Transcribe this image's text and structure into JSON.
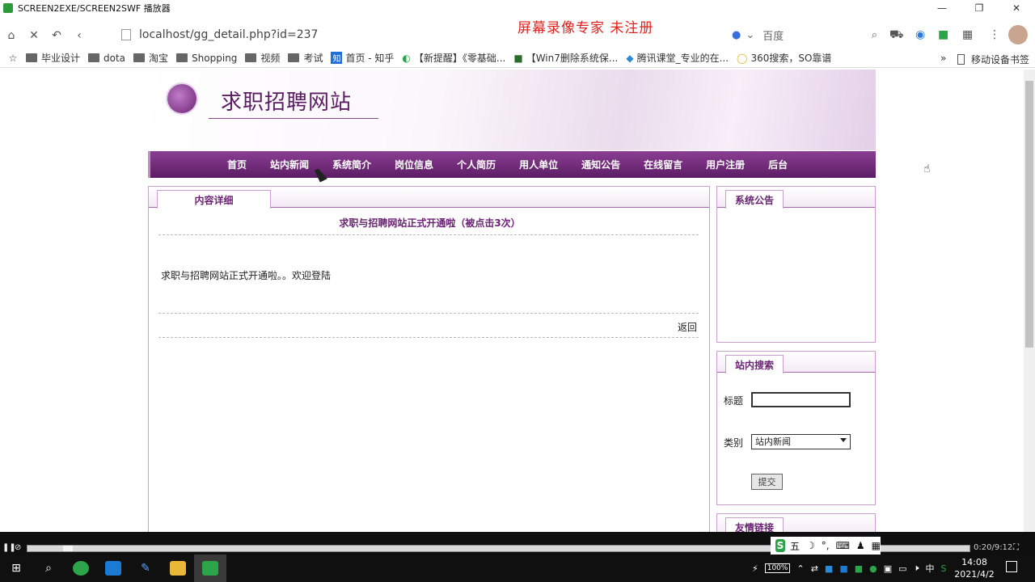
{
  "window": {
    "title": "SCREEN2EXE/SCREEN2SWF 播放器"
  },
  "watermark": "屏幕录像专家 未注册",
  "browser": {
    "url": "localhost/gg_detail.php?id=237",
    "search_engine": "百度",
    "bookmarks": [
      "毕业设计",
      "dota",
      "淘宝",
      "Shopping",
      "视频",
      "考试",
      "首页 - 知乎",
      "【新提醒】《零基础...",
      "【Win7删除系统保...",
      "腾讯课堂_专业的在...",
      "360搜索，SO靠谱"
    ],
    "mobile_bookmarks": "移动设备书签"
  },
  "site": {
    "name": "求职招聘网站",
    "nav": [
      "首页",
      "站内新闻",
      "系统简介",
      "岗位信息",
      "个人简历",
      "用人单位",
      "通知公告",
      "在线留言",
      "用户注册",
      "后台"
    ]
  },
  "main": {
    "tab": "内容详细",
    "title": "求职与招聘网站正式开通啦（被点击3次）",
    "body": "求职与招聘网站正式开通啦。。欢迎登陆",
    "back": "返回"
  },
  "sidebar": {
    "notice_tab": "系统公告",
    "search_tab": "站内搜索",
    "title_label": "标题",
    "title_value": "",
    "category_label": "类别",
    "category_value": "站内新闻",
    "submit": "提交",
    "links_tab": "友情链接"
  },
  "player": {
    "time": "0:20/9:12"
  },
  "ime": {
    "mode": "五"
  },
  "taskbar": {
    "battery": "100%",
    "lang": "中",
    "time": "14:08",
    "date": "2021/4/2"
  }
}
